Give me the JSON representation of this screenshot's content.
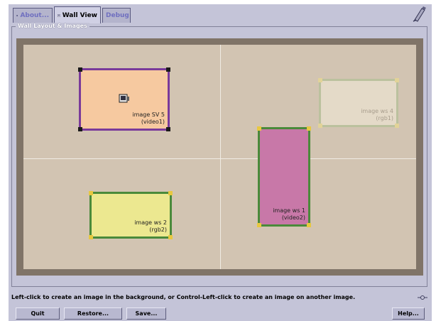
{
  "tabs": [
    {
      "label": "About...",
      "icon": "about-icon"
    },
    {
      "label": "Wall View",
      "icon": "wall-view-icon"
    },
    {
      "label": "Debug",
      "icon": ""
    }
  ],
  "group_title": "Wall Layout & Images",
  "images": [
    {
      "line1": "image SV 5",
      "line2": "(video1)",
      "fill": "#f6c9a0",
      "border": "#7a3a9a"
    },
    {
      "line1": "image ws 4",
      "line2": "(rgb1)",
      "fill": "#eae2d0",
      "border": "#8aa060"
    },
    {
      "line1": "image ws 1",
      "line2": "(video2)",
      "fill": "#c878a8",
      "border": "#4a8a3a"
    },
    {
      "line1": "image ws 2",
      "line2": "(rgb2)",
      "fill": "#ece890",
      "border": "#4a8a3a"
    }
  ],
  "status_message": "Left-click to create an image in the background, or Control-Left-click to create an image on another image.",
  "buttons": {
    "quit": "Quit",
    "restore": "Restore...",
    "save": "Save...",
    "help": "Help..."
  },
  "colors": {
    "window_bg": "#c4c4d8",
    "wall_bg": "#d2c4b2",
    "corner_handle": "#e8c840"
  }
}
